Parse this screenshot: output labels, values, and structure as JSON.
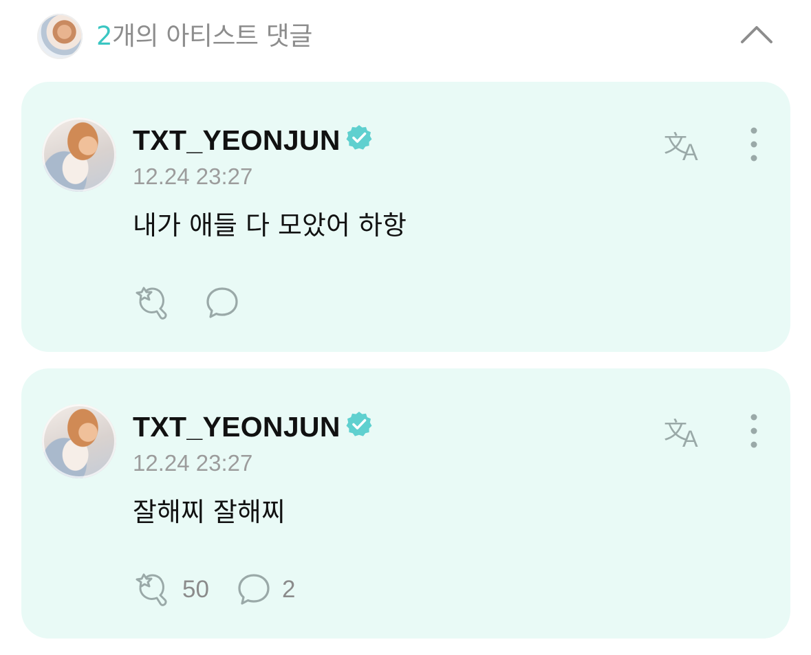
{
  "header": {
    "count": "2",
    "title_suffix": "개의 아티스트 댓글",
    "collapse_icon": "chevron-up-icon"
  },
  "comments": [
    {
      "username": "TXT_YEONJUN",
      "verified": true,
      "timestamp": "12.24 23:27",
      "text": "내가 애들 다 모았어 하항",
      "like_count": "",
      "reply_count": ""
    },
    {
      "username": "TXT_YEONJUN",
      "verified": true,
      "timestamp": "12.24 23:27",
      "text": "잘해찌 잘해찌",
      "like_count": "50",
      "reply_count": "2"
    }
  ],
  "colors": {
    "accent": "#3ac6c2",
    "card_bg": "#e9faf6",
    "verified": "#5fd0cf",
    "icon": "#9aa9a8"
  }
}
